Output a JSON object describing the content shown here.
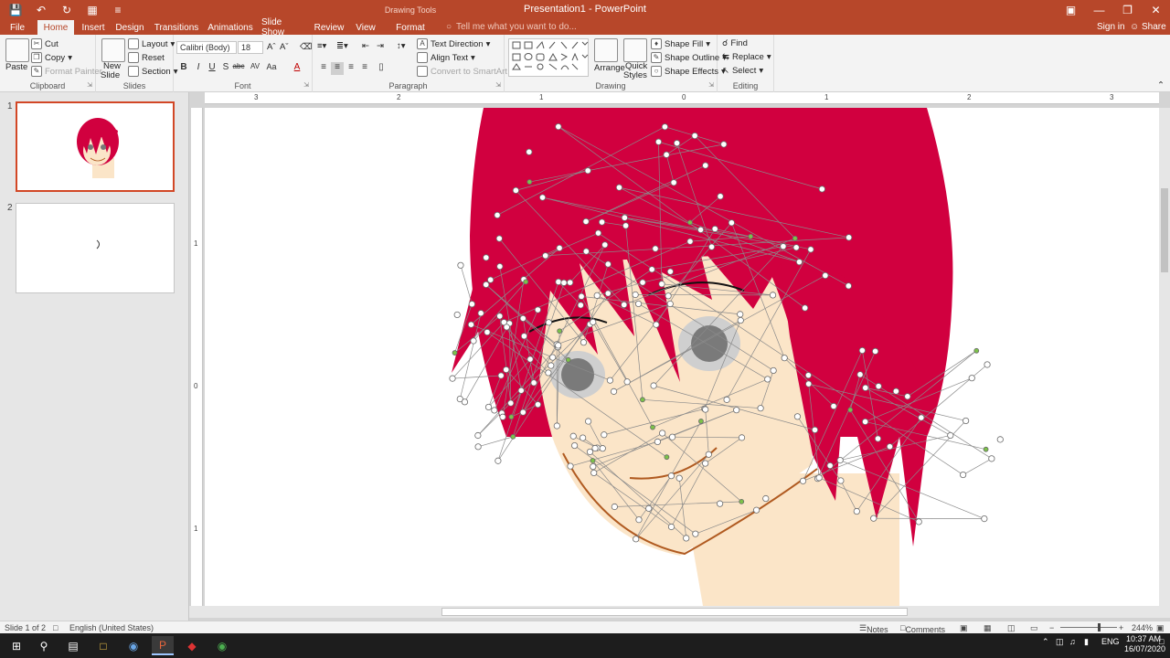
{
  "window": {
    "title": "Presentation1 - PowerPoint",
    "context_tools": "Drawing Tools"
  },
  "tabs": [
    {
      "label": "File"
    },
    {
      "label": "Home"
    },
    {
      "label": "Insert"
    },
    {
      "label": "Design"
    },
    {
      "label": "Transitions"
    },
    {
      "label": "Animations"
    },
    {
      "label": "Slide Show"
    },
    {
      "label": "Review"
    },
    {
      "label": "View"
    },
    {
      "label": "Format"
    }
  ],
  "tell_me": "Tell me what you want to do...",
  "signin": "Sign in",
  "share": "Share",
  "ribbon": {
    "clipboard": {
      "label": "Clipboard",
      "paste": "Paste",
      "cut": "Cut",
      "copy": "Copy",
      "format_painter": "Format Painter"
    },
    "slides": {
      "label": "Slides",
      "new_slide": "New",
      "new_slide2": "Slide",
      "layout": "Layout",
      "reset": "Reset",
      "section": "Section"
    },
    "font": {
      "label": "Font",
      "font_name": "Calibri (Body)",
      "font_size": "18"
    },
    "paragraph": {
      "label": "Paragraph",
      "text_direction": "Text Direction",
      "align_text": "Align Text",
      "convert_smartart": "Convert to SmartArt"
    },
    "drawing": {
      "label": "Drawing",
      "arrange": "Arrange",
      "quick_styles": "Quick",
      "quick_styles2": "Styles",
      "shape_fill": "Shape Fill",
      "shape_outline": "Shape Outline",
      "shape_effects": "Shape Effects"
    },
    "editing": {
      "label": "Editing",
      "find": "Find",
      "replace": "Replace",
      "select": "Select"
    }
  },
  "ruler_h": [
    "3",
    "2",
    "1",
    "0",
    "1",
    "2",
    "3"
  ],
  "ruler_v": [
    "1",
    "0",
    "1"
  ],
  "slides": [
    {
      "number": "1"
    },
    {
      "number": "2"
    }
  ],
  "status": {
    "slide": "Slide 1 of 2",
    "language": "English (United States)",
    "notes": "Notes",
    "comments": "Comments",
    "zoom": "244%"
  },
  "taskbar": {
    "lang": "ENG",
    "time": "10:37 AM",
    "date": "16/07/2020"
  },
  "colors": {
    "hair": "#d1003f",
    "skin": "#fbe5c8",
    "accent": "#b7472a"
  }
}
